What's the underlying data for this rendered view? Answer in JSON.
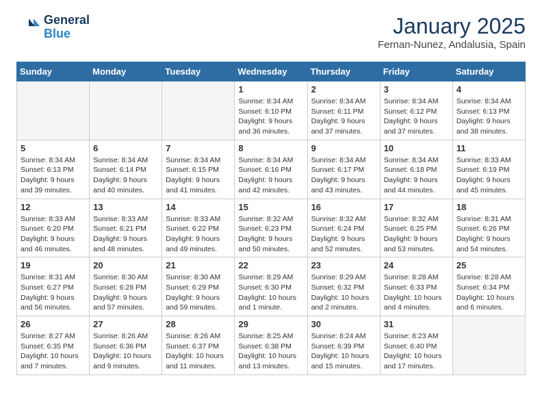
{
  "header": {
    "logo_line1": "General",
    "logo_line2": "Blue",
    "month": "January 2025",
    "location": "Fernan-Nunez, Andalusia, Spain"
  },
  "days_of_week": [
    "Sunday",
    "Monday",
    "Tuesday",
    "Wednesday",
    "Thursday",
    "Friday",
    "Saturday"
  ],
  "weeks": [
    [
      {
        "day": "",
        "info": ""
      },
      {
        "day": "",
        "info": ""
      },
      {
        "day": "",
        "info": ""
      },
      {
        "day": "1",
        "info": "Sunrise: 8:34 AM\nSunset: 6:10 PM\nDaylight: 9 hours and 36 minutes."
      },
      {
        "day": "2",
        "info": "Sunrise: 8:34 AM\nSunset: 6:11 PM\nDaylight: 9 hours and 37 minutes."
      },
      {
        "day": "3",
        "info": "Sunrise: 8:34 AM\nSunset: 6:12 PM\nDaylight: 9 hours and 37 minutes."
      },
      {
        "day": "4",
        "info": "Sunrise: 8:34 AM\nSunset: 6:13 PM\nDaylight: 9 hours and 38 minutes."
      }
    ],
    [
      {
        "day": "5",
        "info": "Sunrise: 8:34 AM\nSunset: 6:13 PM\nDaylight: 9 hours and 39 minutes."
      },
      {
        "day": "6",
        "info": "Sunrise: 8:34 AM\nSunset: 6:14 PM\nDaylight: 9 hours and 40 minutes."
      },
      {
        "day": "7",
        "info": "Sunrise: 8:34 AM\nSunset: 6:15 PM\nDaylight: 9 hours and 41 minutes."
      },
      {
        "day": "8",
        "info": "Sunrise: 8:34 AM\nSunset: 6:16 PM\nDaylight: 9 hours and 42 minutes."
      },
      {
        "day": "9",
        "info": "Sunrise: 8:34 AM\nSunset: 6:17 PM\nDaylight: 9 hours and 43 minutes."
      },
      {
        "day": "10",
        "info": "Sunrise: 8:34 AM\nSunset: 6:18 PM\nDaylight: 9 hours and 44 minutes."
      },
      {
        "day": "11",
        "info": "Sunrise: 8:33 AM\nSunset: 6:19 PM\nDaylight: 9 hours and 45 minutes."
      }
    ],
    [
      {
        "day": "12",
        "info": "Sunrise: 8:33 AM\nSunset: 6:20 PM\nDaylight: 9 hours and 46 minutes."
      },
      {
        "day": "13",
        "info": "Sunrise: 8:33 AM\nSunset: 6:21 PM\nDaylight: 9 hours and 48 minutes."
      },
      {
        "day": "14",
        "info": "Sunrise: 8:33 AM\nSunset: 6:22 PM\nDaylight: 9 hours and 49 minutes."
      },
      {
        "day": "15",
        "info": "Sunrise: 8:32 AM\nSunset: 6:23 PM\nDaylight: 9 hours and 50 minutes."
      },
      {
        "day": "16",
        "info": "Sunrise: 8:32 AM\nSunset: 6:24 PM\nDaylight: 9 hours and 52 minutes."
      },
      {
        "day": "17",
        "info": "Sunrise: 8:32 AM\nSunset: 6:25 PM\nDaylight: 9 hours and 53 minutes."
      },
      {
        "day": "18",
        "info": "Sunrise: 8:31 AM\nSunset: 6:26 PM\nDaylight: 9 hours and 54 minutes."
      }
    ],
    [
      {
        "day": "19",
        "info": "Sunrise: 8:31 AM\nSunset: 6:27 PM\nDaylight: 9 hours and 56 minutes."
      },
      {
        "day": "20",
        "info": "Sunrise: 8:30 AM\nSunset: 6:28 PM\nDaylight: 9 hours and 57 minutes."
      },
      {
        "day": "21",
        "info": "Sunrise: 8:30 AM\nSunset: 6:29 PM\nDaylight: 9 hours and 59 minutes."
      },
      {
        "day": "22",
        "info": "Sunrise: 8:29 AM\nSunset: 6:30 PM\nDaylight: 10 hours and 1 minute."
      },
      {
        "day": "23",
        "info": "Sunrise: 8:29 AM\nSunset: 6:32 PM\nDaylight: 10 hours and 2 minutes."
      },
      {
        "day": "24",
        "info": "Sunrise: 8:28 AM\nSunset: 6:33 PM\nDaylight: 10 hours and 4 minutes."
      },
      {
        "day": "25",
        "info": "Sunrise: 8:28 AM\nSunset: 6:34 PM\nDaylight: 10 hours and 6 minutes."
      }
    ],
    [
      {
        "day": "26",
        "info": "Sunrise: 8:27 AM\nSunset: 6:35 PM\nDaylight: 10 hours and 7 minutes."
      },
      {
        "day": "27",
        "info": "Sunrise: 8:26 AM\nSunset: 6:36 PM\nDaylight: 10 hours and 9 minutes."
      },
      {
        "day": "28",
        "info": "Sunrise: 8:26 AM\nSunset: 6:37 PM\nDaylight: 10 hours and 11 minutes."
      },
      {
        "day": "29",
        "info": "Sunrise: 8:25 AM\nSunset: 6:38 PM\nDaylight: 10 hours and 13 minutes."
      },
      {
        "day": "30",
        "info": "Sunrise: 8:24 AM\nSunset: 6:39 PM\nDaylight: 10 hours and 15 minutes."
      },
      {
        "day": "31",
        "info": "Sunrise: 8:23 AM\nSunset: 6:40 PM\nDaylight: 10 hours and 17 minutes."
      },
      {
        "day": "",
        "info": ""
      }
    ]
  ]
}
